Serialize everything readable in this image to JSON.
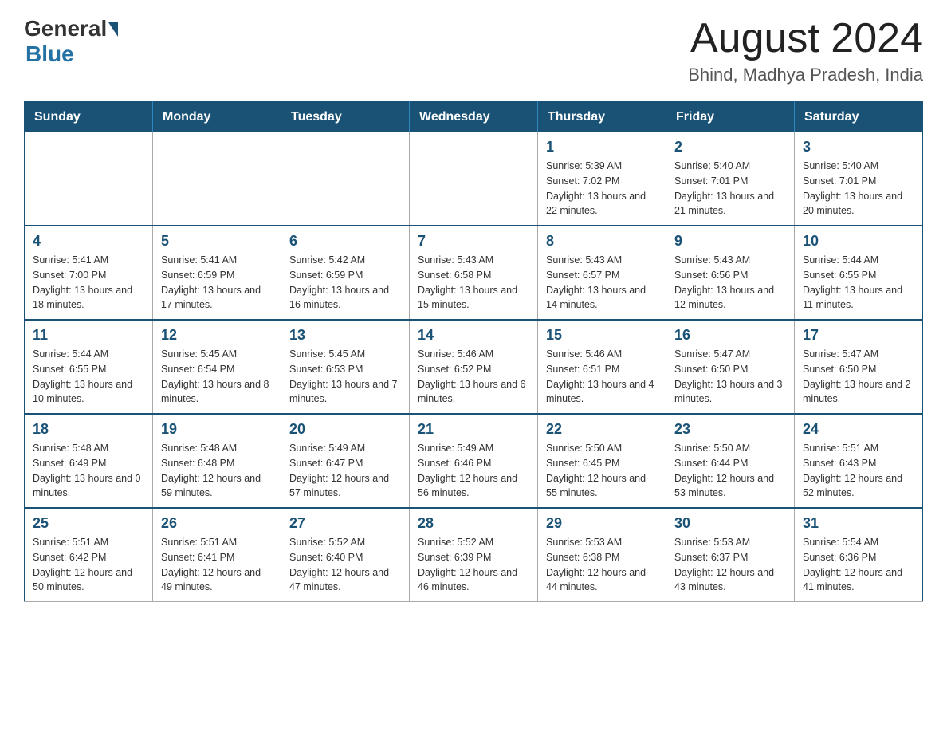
{
  "header": {
    "logo": {
      "general": "General",
      "blue": "Blue"
    },
    "title": "August 2024",
    "subtitle": "Bhind, Madhya Pradesh, India"
  },
  "days_of_week": [
    "Sunday",
    "Monday",
    "Tuesday",
    "Wednesday",
    "Thursday",
    "Friday",
    "Saturday"
  ],
  "weeks": [
    [
      {
        "day": "",
        "info": ""
      },
      {
        "day": "",
        "info": ""
      },
      {
        "day": "",
        "info": ""
      },
      {
        "day": "",
        "info": ""
      },
      {
        "day": "1",
        "info": "Sunrise: 5:39 AM\nSunset: 7:02 PM\nDaylight: 13 hours and 22 minutes."
      },
      {
        "day": "2",
        "info": "Sunrise: 5:40 AM\nSunset: 7:01 PM\nDaylight: 13 hours and 21 minutes."
      },
      {
        "day": "3",
        "info": "Sunrise: 5:40 AM\nSunset: 7:01 PM\nDaylight: 13 hours and 20 minutes."
      }
    ],
    [
      {
        "day": "4",
        "info": "Sunrise: 5:41 AM\nSunset: 7:00 PM\nDaylight: 13 hours and 18 minutes."
      },
      {
        "day": "5",
        "info": "Sunrise: 5:41 AM\nSunset: 6:59 PM\nDaylight: 13 hours and 17 minutes."
      },
      {
        "day": "6",
        "info": "Sunrise: 5:42 AM\nSunset: 6:59 PM\nDaylight: 13 hours and 16 minutes."
      },
      {
        "day": "7",
        "info": "Sunrise: 5:43 AM\nSunset: 6:58 PM\nDaylight: 13 hours and 15 minutes."
      },
      {
        "day": "8",
        "info": "Sunrise: 5:43 AM\nSunset: 6:57 PM\nDaylight: 13 hours and 14 minutes."
      },
      {
        "day": "9",
        "info": "Sunrise: 5:43 AM\nSunset: 6:56 PM\nDaylight: 13 hours and 12 minutes."
      },
      {
        "day": "10",
        "info": "Sunrise: 5:44 AM\nSunset: 6:55 PM\nDaylight: 13 hours and 11 minutes."
      }
    ],
    [
      {
        "day": "11",
        "info": "Sunrise: 5:44 AM\nSunset: 6:55 PM\nDaylight: 13 hours and 10 minutes."
      },
      {
        "day": "12",
        "info": "Sunrise: 5:45 AM\nSunset: 6:54 PM\nDaylight: 13 hours and 8 minutes."
      },
      {
        "day": "13",
        "info": "Sunrise: 5:45 AM\nSunset: 6:53 PM\nDaylight: 13 hours and 7 minutes."
      },
      {
        "day": "14",
        "info": "Sunrise: 5:46 AM\nSunset: 6:52 PM\nDaylight: 13 hours and 6 minutes."
      },
      {
        "day": "15",
        "info": "Sunrise: 5:46 AM\nSunset: 6:51 PM\nDaylight: 13 hours and 4 minutes."
      },
      {
        "day": "16",
        "info": "Sunrise: 5:47 AM\nSunset: 6:50 PM\nDaylight: 13 hours and 3 minutes."
      },
      {
        "day": "17",
        "info": "Sunrise: 5:47 AM\nSunset: 6:50 PM\nDaylight: 13 hours and 2 minutes."
      }
    ],
    [
      {
        "day": "18",
        "info": "Sunrise: 5:48 AM\nSunset: 6:49 PM\nDaylight: 13 hours and 0 minutes."
      },
      {
        "day": "19",
        "info": "Sunrise: 5:48 AM\nSunset: 6:48 PM\nDaylight: 12 hours and 59 minutes."
      },
      {
        "day": "20",
        "info": "Sunrise: 5:49 AM\nSunset: 6:47 PM\nDaylight: 12 hours and 57 minutes."
      },
      {
        "day": "21",
        "info": "Sunrise: 5:49 AM\nSunset: 6:46 PM\nDaylight: 12 hours and 56 minutes."
      },
      {
        "day": "22",
        "info": "Sunrise: 5:50 AM\nSunset: 6:45 PM\nDaylight: 12 hours and 55 minutes."
      },
      {
        "day": "23",
        "info": "Sunrise: 5:50 AM\nSunset: 6:44 PM\nDaylight: 12 hours and 53 minutes."
      },
      {
        "day": "24",
        "info": "Sunrise: 5:51 AM\nSunset: 6:43 PM\nDaylight: 12 hours and 52 minutes."
      }
    ],
    [
      {
        "day": "25",
        "info": "Sunrise: 5:51 AM\nSunset: 6:42 PM\nDaylight: 12 hours and 50 minutes."
      },
      {
        "day": "26",
        "info": "Sunrise: 5:51 AM\nSunset: 6:41 PM\nDaylight: 12 hours and 49 minutes."
      },
      {
        "day": "27",
        "info": "Sunrise: 5:52 AM\nSunset: 6:40 PM\nDaylight: 12 hours and 47 minutes."
      },
      {
        "day": "28",
        "info": "Sunrise: 5:52 AM\nSunset: 6:39 PM\nDaylight: 12 hours and 46 minutes."
      },
      {
        "day": "29",
        "info": "Sunrise: 5:53 AM\nSunset: 6:38 PM\nDaylight: 12 hours and 44 minutes."
      },
      {
        "day": "30",
        "info": "Sunrise: 5:53 AM\nSunset: 6:37 PM\nDaylight: 12 hours and 43 minutes."
      },
      {
        "day": "31",
        "info": "Sunrise: 5:54 AM\nSunset: 6:36 PM\nDaylight: 12 hours and 41 minutes."
      }
    ]
  ]
}
